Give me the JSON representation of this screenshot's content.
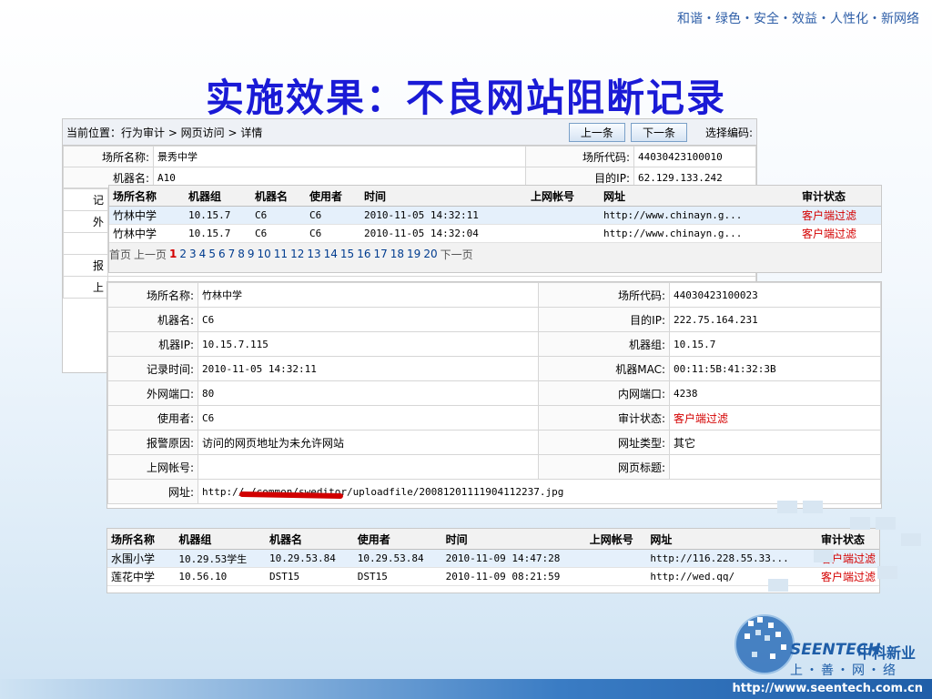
{
  "slogan": "和谐・绿色・安全・效益・人性化・新网络",
  "title": "实施效果：不良网站阻断记录",
  "panel1": {
    "breadcrumb": "当前位置：行为审计 > 网页访问 > 详情",
    "prev_label": "上一条",
    "next_label": "下一条",
    "code_label": "选择编码:",
    "rows": [
      [
        "场所名称:",
        "景秀中学",
        "场所代码:",
        "44030423100010"
      ],
      [
        "机器名:",
        "A10",
        "目的IP:",
        "62.129.133.242"
      ]
    ],
    "stub_labels": [
      "记",
      "外",
      "",
      "报",
      "上"
    ]
  },
  "panel2": {
    "headers": [
      "场所名称",
      "机器组",
      "机器名",
      "使用者",
      "时间",
      "上网帐号",
      "网址",
      "审计状态"
    ],
    "rows": [
      [
        "竹林中学",
        "10.15.7",
        "C6",
        "C6",
        "2010-11-05 14:32:11",
        "",
        "http://www.chinayn.g...",
        "客户端过滤"
      ],
      [
        "竹林中学",
        "10.15.7",
        "C6",
        "C6",
        "2010-11-05 14:32:04",
        "",
        "http://www.chinayn.g...",
        "客户端过滤"
      ]
    ],
    "pager": {
      "first": "首页",
      "prev": "上一页",
      "current": "1",
      "pages": [
        "2",
        "3",
        "4",
        "5",
        "6",
        "7",
        "8",
        "9",
        "10",
        "11",
        "12",
        "13",
        "14",
        "15",
        "16",
        "17",
        "18",
        "19",
        "20"
      ],
      "next": "下一页"
    }
  },
  "panel3": {
    "rows": [
      [
        "场所名称:",
        "竹林中学",
        "场所代码:",
        "44030423100023"
      ],
      [
        "机器名:",
        "C6",
        "目的IP:",
        "222.75.164.231"
      ],
      [
        "机器IP:",
        "10.15.7.115",
        "机器组:",
        "10.15.7"
      ],
      [
        "记录时间:",
        "2010-11-05 14:32:11",
        "机器MAC:",
        "00:11:5B:41:32:3B"
      ],
      [
        "外网端口:",
        "80",
        "内网端口:",
        "4238"
      ],
      [
        "使用者:",
        "C6",
        "审计状态:",
        "客户端过滤"
      ],
      [
        "报警原因:",
        "访问的网页地址为未允许网站",
        "网址类型:",
        "其它"
      ],
      [
        "上网帐号:",
        "",
        "网页标题:",
        ""
      ]
    ],
    "url_label": "网址:",
    "url_value": "http://                          /common/sweditor/uploadfile/20081201111904112237.jpg"
  },
  "panel4": {
    "headers": [
      "场所名称",
      "机器组",
      "机器名",
      "使用者",
      "时间",
      "上网帐号",
      "网址",
      "审计状态"
    ],
    "rows": [
      [
        "水围小学",
        "10.29.53学生",
        "10.29.53.84",
        "10.29.53.84",
        "2010-11-09 14:47:28",
        "",
        "http://116.228.55.33...",
        "客户端过滤"
      ],
      [
        "莲花中学",
        "10.56.10",
        "DST15",
        "DST15",
        "2010-11-09 08:21:59",
        "",
        "http://wed.qq/",
        "客户端过滤"
      ]
    ]
  },
  "logo": {
    "brand_en": "SEENTECH",
    "brand_cn": "中科新业",
    "tagline": "上・善・网・络"
  },
  "footer_url": "http://www.seentech.com.cn",
  "colors": {
    "title": "#1a1ad6",
    "status_red": "#d40000",
    "brand_blue": "#1f5ea8"
  }
}
